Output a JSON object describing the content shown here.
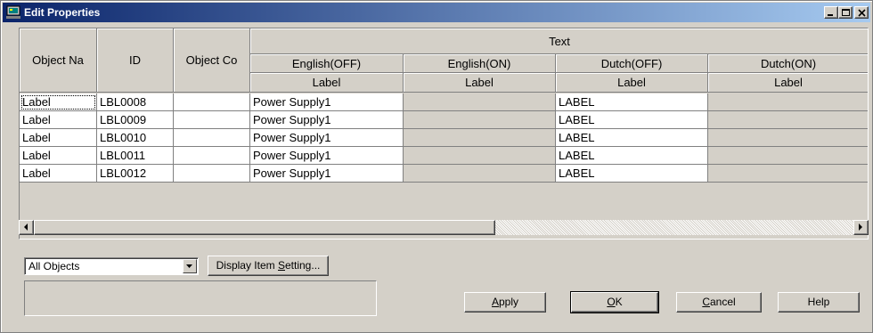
{
  "window": {
    "title": "Edit Properties"
  },
  "columns": {
    "object_name": "Object Na",
    "id": "ID",
    "object_comment": "Object Co",
    "text_group": "Text",
    "languages": [
      {
        "name": "English(OFF)",
        "sub": "Label"
      },
      {
        "name": "English(ON)",
        "sub": "Label"
      },
      {
        "name": "Dutch(OFF)",
        "sub": "Label"
      },
      {
        "name": "Dutch(ON)",
        "sub": "Label"
      }
    ]
  },
  "rows": [
    {
      "object_name": "Label",
      "id": "LBL0008",
      "comment": "",
      "en_off": "Power Supply1",
      "en_on": "",
      "nl_off": "LABEL",
      "nl_on": ""
    },
    {
      "object_name": "Label",
      "id": "LBL0009",
      "comment": "",
      "en_off": "Power Supply1",
      "en_on": "",
      "nl_off": "LABEL",
      "nl_on": ""
    },
    {
      "object_name": "Label",
      "id": "LBL0010",
      "comment": "",
      "en_off": "Power Supply1",
      "en_on": "",
      "nl_off": "LABEL",
      "nl_on": ""
    },
    {
      "object_name": "Label",
      "id": "LBL0011",
      "comment": "",
      "en_off": "Power Supply1",
      "en_on": "",
      "nl_off": "LABEL",
      "nl_on": ""
    },
    {
      "object_name": "Label",
      "id": "LBL0012",
      "comment": "",
      "en_off": "Power Supply1",
      "en_on": "",
      "nl_off": "LABEL",
      "nl_on": ""
    }
  ],
  "filter": {
    "selected": "All Objects"
  },
  "buttons": {
    "display_setting_pre": "Display Item ",
    "display_setting_key": "S",
    "display_setting_post": "etting...",
    "apply_key": "A",
    "apply_rest": "pply",
    "ok_key": "O",
    "ok_rest": "K",
    "cancel_key": "C",
    "cancel_rest": "ancel",
    "help": "Help"
  },
  "colors": {
    "title_start": "#0a246a",
    "title_end": "#a6caf0",
    "face": "#d4d0c8"
  }
}
